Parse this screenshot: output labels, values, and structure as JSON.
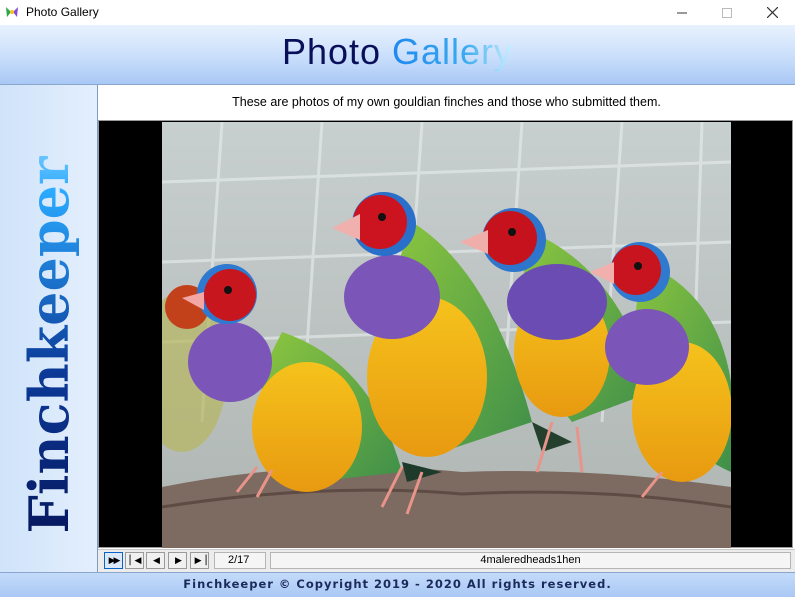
{
  "window": {
    "title": "Photo Gallery",
    "icon": "finch-app-icon",
    "controls": [
      "minimize-icon",
      "maximize-icon",
      "close-icon"
    ]
  },
  "header": {
    "title_part1": "Photo",
    "title_part2": "Gallery"
  },
  "sidebar": {
    "brand_text": "Finchkeeper"
  },
  "caption": "These are photos of my own gouldian finches and those who submitted them.",
  "viewer": {
    "image_alt": "four gouldian finches on a branch",
    "nav_buttons": [
      {
        "name": "play-button",
        "icon": "fast-forward-icon",
        "glyph": "▶▶"
      },
      {
        "name": "first-button",
        "icon": "skip-first-icon",
        "glyph": "▏◀"
      },
      {
        "name": "previous-button",
        "icon": "previous-icon",
        "glyph": "◀"
      },
      {
        "name": "next-button",
        "icon": "next-icon",
        "glyph": "▶"
      },
      {
        "name": "last-button",
        "icon": "skip-last-icon",
        "glyph": "▶▕"
      }
    ],
    "page_indicator": "2/17",
    "image_name": "4maleredheads1hen"
  },
  "footer": {
    "copyright": "Finchkeeper © Copyright 2019 - 2020 All rights reserved."
  },
  "colors": {
    "header_gradient_top": "#e9f2fe",
    "header_gradient_bottom": "#a9c8f5",
    "title_dark": "#0a0f5a",
    "title_light": "#1e88f0",
    "footer_text": "#1b2a5c"
  }
}
